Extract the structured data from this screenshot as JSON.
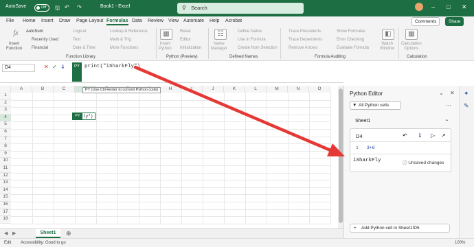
{
  "titlebar": {
    "autosave": "AutoSave",
    "toggle": "Off",
    "doc_title": "Book1 - Excel",
    "search_placeholder": "Search"
  },
  "menu": {
    "items": [
      "File",
      "Home",
      "Insert",
      "Draw",
      "Page Layout",
      "Formulas",
      "Data",
      "Review",
      "View",
      "Automate",
      "Help",
      "Acrobat"
    ],
    "active": "Formulas",
    "comments": "Comments",
    "share": "Share"
  },
  "ribbon": {
    "insert_function": "Insert\nFunction",
    "autosum": "AutoSum",
    "recently_used": "Recently Used",
    "financial": "Financial",
    "logical": "Logical",
    "text": "Text",
    "date_time": "Date & Time",
    "lookup": "Lookup & Reference",
    "math": "Math & Trig",
    "more": "More Functions",
    "group_function_library": "Function Library",
    "insert_python": "Insert\nPython",
    "reset": "Reset",
    "editor": "Editor",
    "initialization": "Initialization",
    "group_python": "Python (Preview)",
    "name_manager": "Name\nManager",
    "define_name": "Define Name",
    "use_in_formula": "Use in Formula",
    "create_from_selection": "Create from Selection",
    "group_defined_names": "Defined Names",
    "trace_precedents": "Trace Precedents",
    "trace_dependents": "Trace Dependents",
    "remove_arrows": "Remove Arrows",
    "show_formulas": "Show Formulas",
    "error_checking": "Error Checking",
    "evaluate_formula": "Evaluate Formula",
    "group_formula_auditing": "Formula Auditing",
    "watch_window": "Watch\nWindow",
    "calc_options": "Calculation\nOptions",
    "group_calculation": "Calculation"
  },
  "formula_bar": {
    "name_box": "D4",
    "py": "PY",
    "formula": "print(\"iSharkFly\")"
  },
  "grid": {
    "columns": [
      "A",
      "B",
      "C",
      "D",
      "E",
      "F",
      "G",
      "H",
      "I",
      "J",
      "K",
      "L",
      "M",
      "N",
      "O"
    ],
    "rows": [
      "1",
      "2",
      "3",
      "4",
      "5",
      "6",
      "7",
      "8",
      "9",
      "10",
      "11",
      "12",
      "13",
      "14",
      "15",
      "16",
      "17",
      "18"
    ],
    "tooltip": "PY (Use Ctrl+Enter to commit Python code)",
    "cell_badge": "PY",
    "cell_text": "ly\")"
  },
  "tabs": {
    "sheet": "Sheet1"
  },
  "status": {
    "mode": "Edit",
    "accessibility": "Accessibility: Good to go",
    "zoom": "100%"
  },
  "python_editor": {
    "title": "Python Editor",
    "filter": "All Python cells",
    "sheet": "Sheet1",
    "cell_name": "D4",
    "line_number": "1",
    "code": "3+6",
    "output": "iSharkFly",
    "unsaved": "Unsaved changes",
    "add_cell": "Add Python cell in Sheet1!D5"
  },
  "colors": {
    "excel_green": "#1e6e43",
    "arrow_red": "#e53935"
  }
}
